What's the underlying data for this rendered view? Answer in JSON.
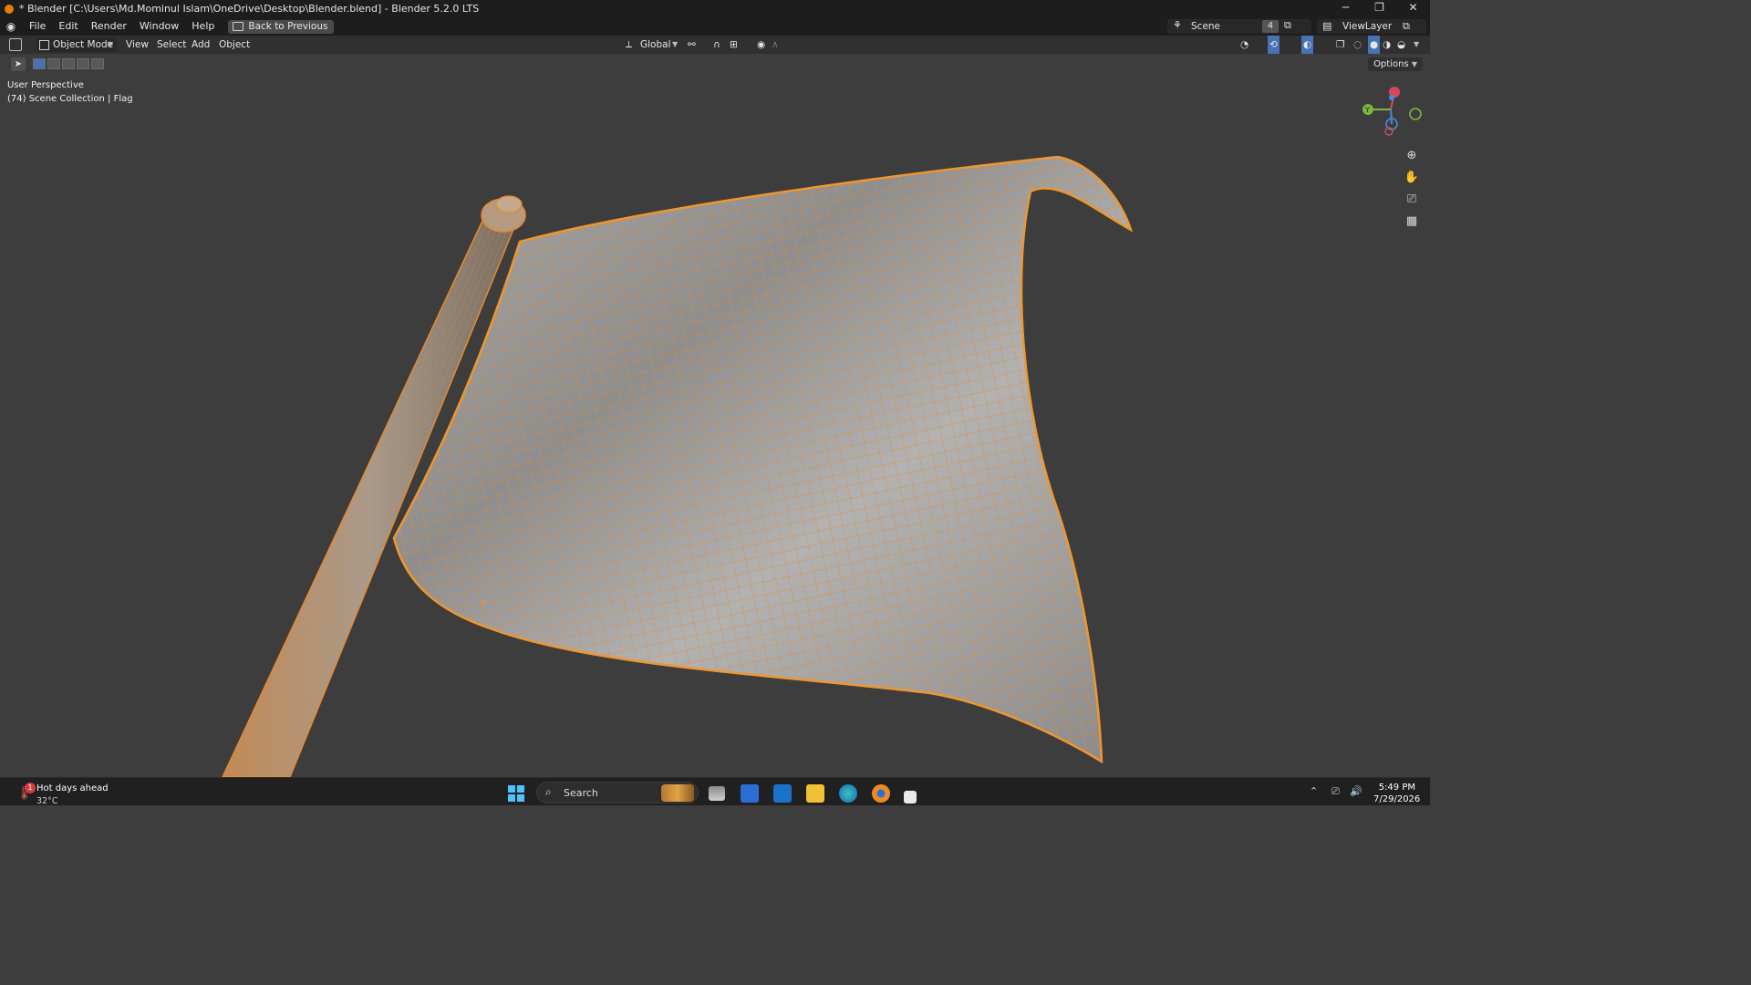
{
  "window": {
    "title": "* Blender [C:\\Users\\Md.Mominul Islam\\OneDrive\\Desktop\\Blender.blend] - Blender 5.2.0 LTS",
    "controls": [
      "─",
      "❐",
      "✕"
    ]
  },
  "menu": {
    "items": [
      "File",
      "Edit",
      "Render",
      "Window",
      "Help"
    ],
    "back_button": "Back to Previous"
  },
  "scene": {
    "label": "Scene",
    "count": "4"
  },
  "view_layer": {
    "label": "ViewLayer"
  },
  "header": {
    "mode": "Object Mode",
    "menus": [
      "View",
      "Select",
      "Add",
      "Object"
    ],
    "orientation": "Global"
  },
  "toolbar": {
    "options_label": "Options"
  },
  "viewport": {
    "perspective": "User Perspective",
    "collection": "(74) Scene Collection | Flag",
    "selection_color": "#e8892a",
    "flag_color": "#9a9a9a",
    "gizmo_axes": [
      "X",
      "Y",
      "Z"
    ]
  },
  "taskbar": {
    "weather_title": "Hot days ahead",
    "weather_temp": "32°C",
    "weather_badge": "1",
    "search_label": "Search",
    "time": "5:49 PM",
    "date": "7/29/2026"
  }
}
